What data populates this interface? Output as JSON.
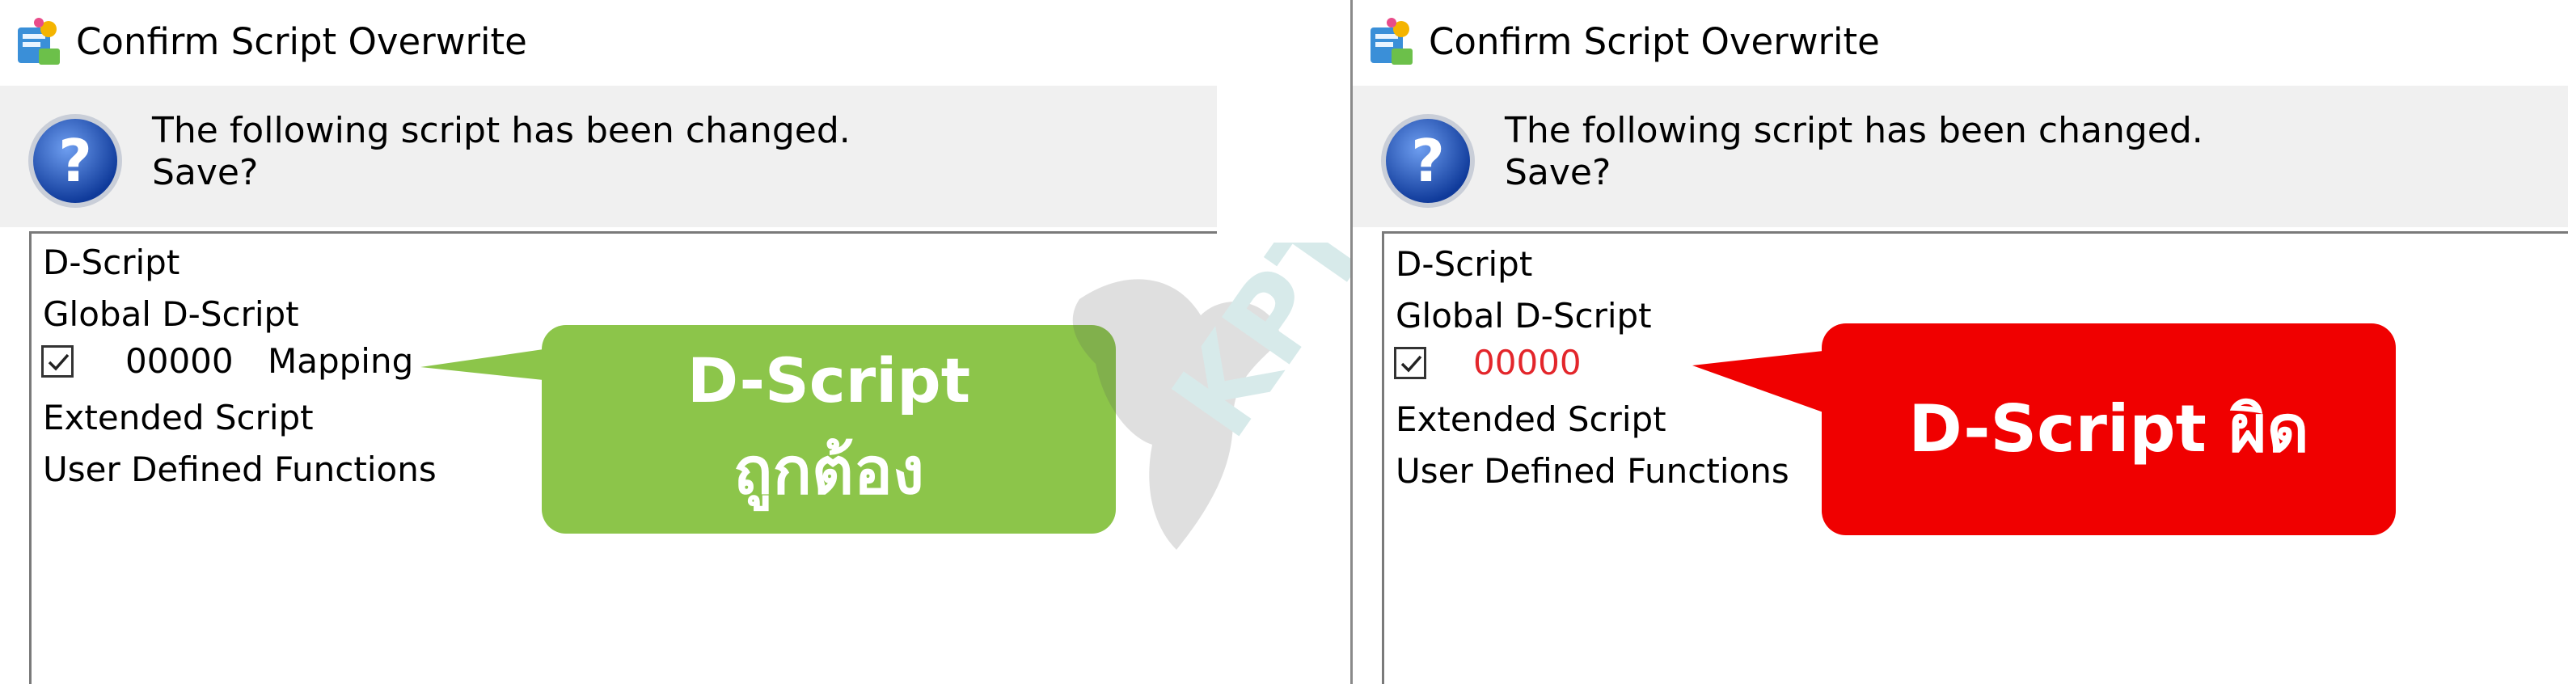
{
  "dialog": {
    "title": "Confirm Script Overwrite",
    "message_line1": "The following script has been changed.",
    "message_line2": "Save?",
    "app_icon": "script-app-icon",
    "question_icon": "question-icon"
  },
  "left_panel": {
    "items": [
      {
        "label": "D-Script"
      },
      {
        "label": "Global D-Script"
      },
      {
        "checked": true,
        "code": "00000",
        "name": "Mapping"
      },
      {
        "label": "Extended Script"
      },
      {
        "label": "User Defined Functions"
      }
    ],
    "callout": {
      "line1": "D-Script",
      "line2": "ถูกต้อง",
      "color": "#8cc54a"
    }
  },
  "right_panel": {
    "items": [
      {
        "label": "D-Script"
      },
      {
        "label": "Global D-Script"
      },
      {
        "checked": true,
        "code": "00000",
        "code_color": "#e3262b"
      },
      {
        "label": "Extended Script"
      },
      {
        "label": "User Defined Functions"
      }
    ],
    "callout": {
      "text": "D-Script ผิด",
      "color": "#f00000"
    }
  },
  "watermark": {
    "text": "KPT"
  }
}
